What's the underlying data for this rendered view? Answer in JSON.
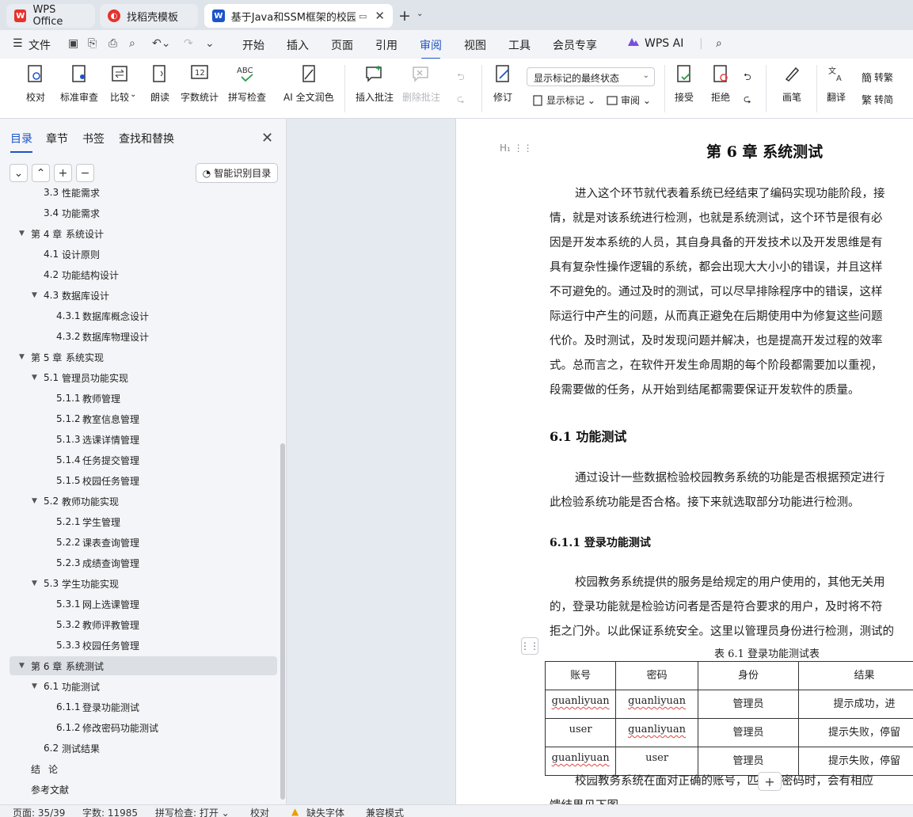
{
  "tabs": [
    {
      "label": "WPS Office",
      "color": "#e5322d"
    },
    {
      "label": "找稻壳模板",
      "color": "#e5322d"
    },
    {
      "label": "基于Java和SSM框架的校园教",
      "color": "#1c54c9"
    }
  ],
  "menu": {
    "file": "文件",
    "items": [
      "开始",
      "插入",
      "页面",
      "引用",
      "审阅",
      "视图",
      "工具",
      "会员专享"
    ],
    "active": "审阅",
    "wps_ai": "WPS AI"
  },
  "ribbon": {
    "proofread": "校对",
    "standard_review": "标准审查",
    "compare": "比较",
    "read_aloud": "朗读",
    "word_count": "字数统计",
    "spell_check": "拼写检查",
    "ai_polish": "AI 全文润色",
    "insert_comment": "插入批注",
    "delete_comment": "删除批注",
    "track_changes": "修订",
    "markup_dropdown": "显示标记的最终状态",
    "show_markup": "显示标记",
    "review_pane": "审阅",
    "accept": "接受",
    "reject": "拒绝",
    "pen": "画笔",
    "translate": "翻译",
    "to_traditional": "转繁",
    "to_simplified": "转简"
  },
  "leftpanel": {
    "tabs": [
      "目录",
      "章节",
      "书签",
      "查找和替换"
    ],
    "active_tab": "目录",
    "smart_toc": "智能识别目录",
    "toc": [
      {
        "num": "3.3",
        "title": "性能需求",
        "level": 2
      },
      {
        "num": "3.4",
        "title": "功能需求",
        "level": 2
      },
      {
        "num": "第 4 章",
        "title": "系统设计",
        "level": 1,
        "expanded": true
      },
      {
        "num": "4.1",
        "title": "设计原则",
        "level": 2
      },
      {
        "num": "4.2",
        "title": "功能结构设计",
        "level": 2
      },
      {
        "num": "4.3",
        "title": "数据库设计",
        "level": 2,
        "expanded": true
      },
      {
        "num": "4.3.1",
        "title": "数据库概念设计",
        "level": 3
      },
      {
        "num": "4.3.2",
        "title": "数据库物理设计",
        "level": 3
      },
      {
        "num": "第 5 章",
        "title": "系统实现",
        "level": 1,
        "expanded": true
      },
      {
        "num": "5.1",
        "title": "管理员功能实现",
        "level": 2,
        "expanded": true
      },
      {
        "num": "5.1.1",
        "title": "教师管理",
        "level": 3
      },
      {
        "num": "5.1.2",
        "title": "教室信息管理",
        "level": 3
      },
      {
        "num": "5.1.3",
        "title": "选课详情管理",
        "level": 3
      },
      {
        "num": "5.1.4",
        "title": "任务提交管理",
        "level": 3
      },
      {
        "num": "5.1.5",
        "title": "校园任务管理",
        "level": 3
      },
      {
        "num": "5.2",
        "title": "教师功能实现",
        "level": 2,
        "expanded": true
      },
      {
        "num": "5.2.1",
        "title": "学生管理",
        "level": 3
      },
      {
        "num": "5.2.2",
        "title": "课表查询管理",
        "level": 3
      },
      {
        "num": "5.2.3",
        "title": "成绩查询管理",
        "level": 3
      },
      {
        "num": "5.3",
        "title": "学生功能实现",
        "level": 2,
        "expanded": true
      },
      {
        "num": "5.3.1",
        "title": "网上选课管理",
        "level": 3
      },
      {
        "num": "5.3.2",
        "title": "教师评教管理",
        "level": 3
      },
      {
        "num": "5.3.3",
        "title": "校园任务管理",
        "level": 3
      },
      {
        "num": "第 6 章",
        "title": "系统测试",
        "level": 1,
        "expanded": true,
        "selected": true
      },
      {
        "num": "6.1",
        "title": "功能测试",
        "level": 2,
        "expanded": true
      },
      {
        "num": "6.1.1",
        "title": "登录功能测试",
        "level": 3
      },
      {
        "num": "6.1.2",
        "title": "修改密码功能测试",
        "level": 3
      },
      {
        "num": "6.2",
        "title": "测试结果",
        "level": 2
      },
      {
        "num": "结",
        "title": "论",
        "level": 1
      },
      {
        "num": "参考文献",
        "title": "",
        "level": 1
      }
    ]
  },
  "document": {
    "chapter_title": "第 6 章  系统测试",
    "para1": [
      "进入这个环节就代表着系统已经结束了编码实现功能阶段，接",
      "情，就是对该系统进行检测，也就是系统测试，这个环节是很有必",
      "因是开发本系统的人员，其自身具备的开发技术以及开发思维是有",
      "具有复杂性操作逻辑的系统，都会出现大大小小的错误，并且这样",
      "不可避免的。通过及时的测试，可以尽早排除程序中的错误，这样",
      "际运行中产生的问题，从而真正避免在后期使用中为修复这些问题",
      "代价。及时测试，及时发现问题并解决，也是提高开发过程的效率",
      "式。总而言之，在软件开发生命周期的每个阶段都需要加以重视，",
      "段需要做的任务，从开始到结尾都需要保证开发软件的质量。"
    ],
    "h2_6_1": "6.1  功能测试",
    "para2": [
      "通过设计一些数据检验校园教务系统的功能是否根据预定进行",
      "此检验系统功能是否合格。接下来就选取部分功能进行检测。"
    ],
    "h3_6_1_1": "6.1.1  登录功能测试",
    "para3": [
      "校园教务系统提供的服务是给规定的用户使用的，其他无关用",
      "的，登录功能就是检验访问者是否是符合要求的用户，及时将不符",
      "拒之门外。以此保证系统安全。这里以管理员身份进行检测，测试的"
    ],
    "table_caption": "表 6.1  登录功能测试表",
    "table": {
      "headers": [
        "账号",
        "密码",
        "身份",
        "结果"
      ],
      "rows": [
        [
          "guanliyuan",
          "guanliyuan",
          "管理员",
          "提示成功，进"
        ],
        [
          "user",
          "guanliyuan",
          "管理员",
          "提示失败，停留"
        ],
        [
          "guanliyuan",
          "user",
          "管理员",
          "提示失败，停留"
        ]
      ]
    },
    "para4": [
      "校园教务系统在面对正确的账号，匹配的密码时，会有相应",
      "馈结果见下图"
    ]
  },
  "statusbar": {
    "page": "页面: 35/39",
    "words": "字数: 11985",
    "spell": "拼写检查: 打开",
    "proof": "校对",
    "missing_font": "缺失字体",
    "compat": "兼容模式"
  }
}
